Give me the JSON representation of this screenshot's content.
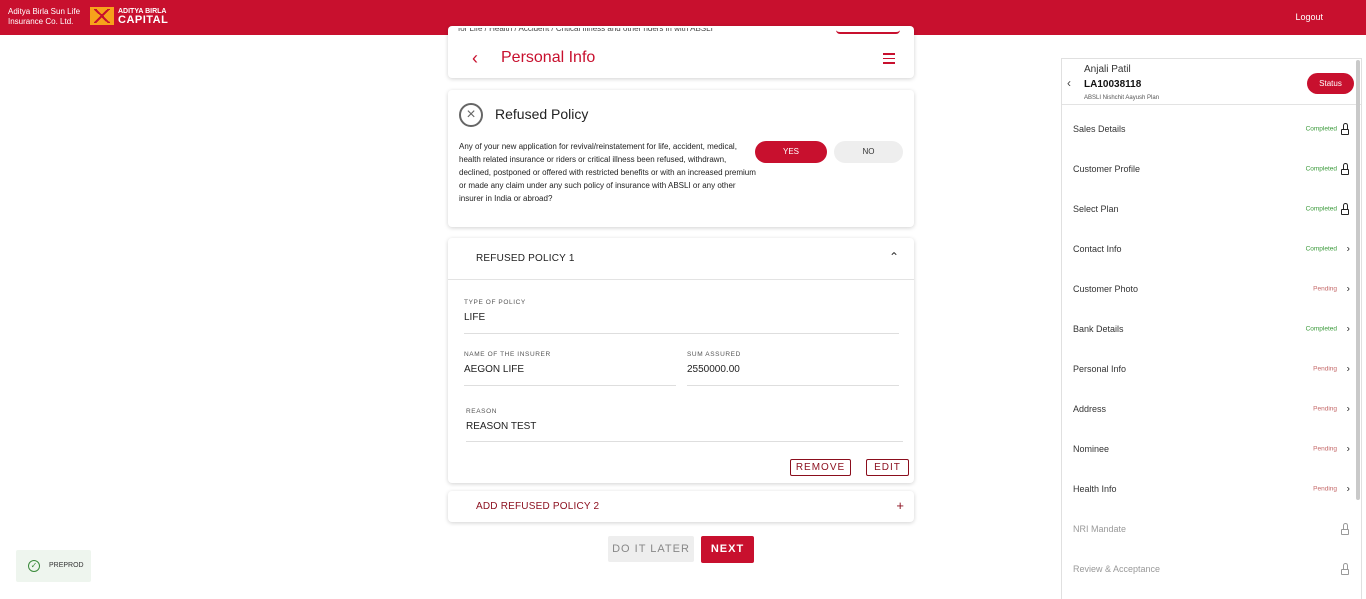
{
  "topbar": {
    "brand_line1": "Aditya Birla Sun Life",
    "brand_line2": "Insurance Co. Ltd.",
    "capital_small": "ADITYA BIRLA",
    "capital_big": "CAPITAL",
    "logout_label": "Logout",
    "bg_color": "#c8102e"
  },
  "header": {
    "cut_text": "for Life / Health / Accident / Critical Illness and other riders in with ABSLI",
    "title": "Personal Info"
  },
  "refused_policy": {
    "title": "Refused Policy",
    "question": "Any of your new application for revival/reinstatement for life, accident, medical, health related insurance or riders or critical illness been refused, withdrawn, declined, postponed or offered with restricted benefits or with an increased premium or made any claim under any such policy of insurance with ABSLI or any other insurer in India or abroad?",
    "yes_label": "YES",
    "no_label": "NO",
    "selected": "YES"
  },
  "policy_1": {
    "title": "REFUSED POLICY 1",
    "type_label": "TYPE OF POLICY",
    "type_value": "LIFE",
    "insurer_label": "NAME OF THE INSURER",
    "insurer_value": "AEGON LIFE",
    "sum_label": "SUM ASSURED",
    "sum_value": "2550000.00",
    "reason_label": "REASON",
    "reason_value": "REASON TEST",
    "remove_label": "REMOVE",
    "edit_label": "EDIT"
  },
  "add_policy": {
    "title": "ADD REFUSED POLICY 2"
  },
  "actions": {
    "later_label": "DO IT LATER",
    "next_label": "NEXT"
  },
  "badge": {
    "label": "PREPROD"
  },
  "sidebar": {
    "name": "Anjali Patil",
    "id": "LA10038118",
    "plan": "ABSLI Nishchit Aayush Plan",
    "status_label": "Status",
    "items": [
      {
        "label": "Sales Details",
        "status": "Completed",
        "icon": "lock-icon"
      },
      {
        "label": "Customer Profile",
        "status": "Completed",
        "icon": "lock-icon"
      },
      {
        "label": "Select Plan",
        "status": "Completed",
        "icon": "lock-icon"
      },
      {
        "label": "Contact Info",
        "status": "Completed",
        "icon": "chevron-right-icon"
      },
      {
        "label": "Customer Photo",
        "status": "Pending",
        "icon": "chevron-right-icon"
      },
      {
        "label": "Bank Details",
        "status": "Completed",
        "icon": "chevron-right-icon"
      },
      {
        "label": "Personal Info",
        "status": "Pending",
        "icon": "chevron-right-icon"
      },
      {
        "label": "Address",
        "status": "Pending",
        "icon": "chevron-right-icon"
      },
      {
        "label": "Nominee",
        "status": "Pending",
        "icon": "chevron-right-icon"
      },
      {
        "label": "Health Info",
        "status": "Pending",
        "icon": "chevron-right-icon"
      },
      {
        "label": "NRI Mandate",
        "status": "",
        "icon": "lock-icon"
      },
      {
        "label": "Review & Acceptance",
        "status": "",
        "icon": "lock-icon"
      }
    ]
  }
}
